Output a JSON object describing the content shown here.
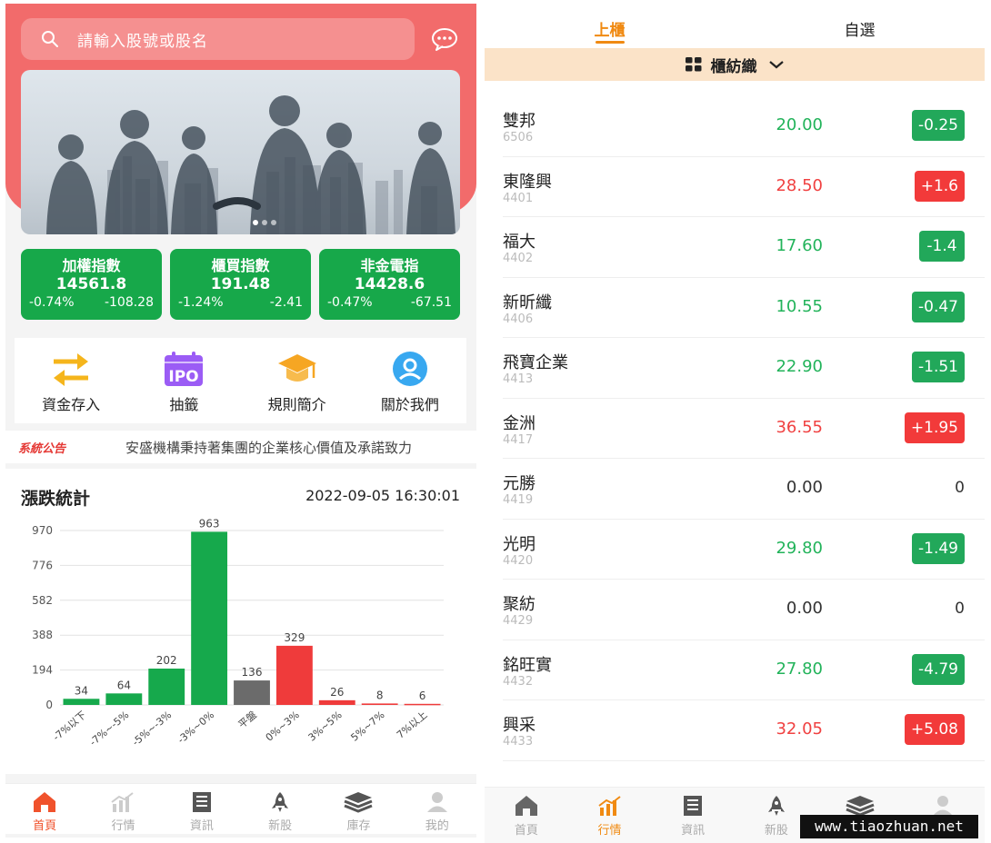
{
  "left": {
    "search": {
      "placeholder": "請輸入股號或股名"
    },
    "indices": [
      {
        "name": "加權指數",
        "value": "14561.8",
        "pct": "-0.74%",
        "change": "-108.28"
      },
      {
        "name": "櫃買指數",
        "value": "191.48",
        "pct": "-1.24%",
        "change": "-2.41"
      },
      {
        "name": "非金電指",
        "value": "14428.6",
        "pct": "-0.47%",
        "change": "-67.51"
      }
    ],
    "menu": [
      {
        "label": "資金存入",
        "icon": "transfer-arrows-icon"
      },
      {
        "label": "抽籤",
        "icon": "ipo-calendar-icon"
      },
      {
        "label": "規則簡介",
        "icon": "graduation-cap-icon"
      },
      {
        "label": "關於我們",
        "icon": "user-avatar-icon"
      }
    ],
    "notice": {
      "tag": "系統公告",
      "text": "安盛機構秉持著集團的企業核心價值及承諾致力"
    },
    "stats": {
      "title": "漲跌統計",
      "datetime": "2022-09-05 16:30:01"
    },
    "tabbar": [
      {
        "label": "首頁",
        "icon": "home-icon",
        "active": true
      },
      {
        "label": "行情",
        "icon": "chart-icon",
        "active": false
      },
      {
        "label": "資訊",
        "icon": "news-icon",
        "active": false
      },
      {
        "label": "新股",
        "icon": "rocket-icon",
        "active": false
      },
      {
        "label": "庫存",
        "icon": "layers-icon",
        "active": false
      },
      {
        "label": "我的",
        "icon": "user-icon",
        "active": false
      }
    ]
  },
  "chart_data": {
    "type": "bar",
    "title": "",
    "categories": [
      "-7%以下",
      "-7%~-5%",
      "-5%~-3%",
      "-3%~0%",
      "平盤",
      "0%~3%",
      "3%~5%",
      "5%~7%",
      "7%以上"
    ],
    "values": [
      34,
      64,
      202,
      963,
      136,
      329,
      26,
      8,
      6
    ],
    "bar_colors": [
      "#16a94c",
      "#16a94c",
      "#16a94c",
      "#16a94c",
      "#6b6b6b",
      "#ef3b3b",
      "#ef3b3b",
      "#ef3b3b",
      "#ef3b3b"
    ],
    "yticks": [
      0,
      194,
      388,
      582,
      776,
      970
    ],
    "ylim": [
      0,
      970
    ],
    "grid": true,
    "xlabel": "",
    "ylabel": ""
  },
  "right": {
    "tabs": [
      {
        "label": "上櫃",
        "active": true
      },
      {
        "label": "自選",
        "active": false
      }
    ],
    "category": "櫃紡織",
    "stocks": [
      {
        "name": "雙邦",
        "code": "6506",
        "price": "20.00",
        "change": "-0.25",
        "dir": "down"
      },
      {
        "name": "東隆興",
        "code": "4401",
        "price": "28.50",
        "change": "+1.6",
        "dir": "up"
      },
      {
        "name": "福大",
        "code": "4402",
        "price": "17.60",
        "change": "-1.4",
        "dir": "down"
      },
      {
        "name": "新昕纖",
        "code": "4406",
        "price": "10.55",
        "change": "-0.47",
        "dir": "down"
      },
      {
        "name": "飛寶企業",
        "code": "4413",
        "price": "22.90",
        "change": "-1.51",
        "dir": "down"
      },
      {
        "name": "金洲",
        "code": "4417",
        "price": "36.55",
        "change": "+1.95",
        "dir": "up"
      },
      {
        "name": "元勝",
        "code": "4419",
        "price": "0.00",
        "change": "0",
        "dir": "flat"
      },
      {
        "name": "光明",
        "code": "4420",
        "price": "29.80",
        "change": "-1.49",
        "dir": "down"
      },
      {
        "name": "聚紡",
        "code": "4429",
        "price": "0.00",
        "change": "0",
        "dir": "flat"
      },
      {
        "name": "銘旺實",
        "code": "4432",
        "price": "27.80",
        "change": "-4.79",
        "dir": "down"
      },
      {
        "name": "興采",
        "code": "4433",
        "price": "32.05",
        "change": "+5.08",
        "dir": "up"
      }
    ],
    "tabbar": [
      {
        "label": "首頁",
        "icon": "home-icon",
        "active": false
      },
      {
        "label": "行情",
        "icon": "chart-icon",
        "active": true
      },
      {
        "label": "資訊",
        "icon": "news-icon",
        "active": false
      },
      {
        "label": "新股",
        "icon": "rocket-icon",
        "active": false
      },
      {
        "label": "",
        "icon": "layers-icon",
        "active": false
      },
      {
        "label": "",
        "icon": "user-icon",
        "active": false
      }
    ]
  },
  "watermark": "www.tiaozhuan.net",
  "colors": {
    "primary_red": "#f26b6b",
    "up_red": "#f23a3a",
    "down_green": "#22a85a",
    "accent_orange": "#f08a12"
  }
}
